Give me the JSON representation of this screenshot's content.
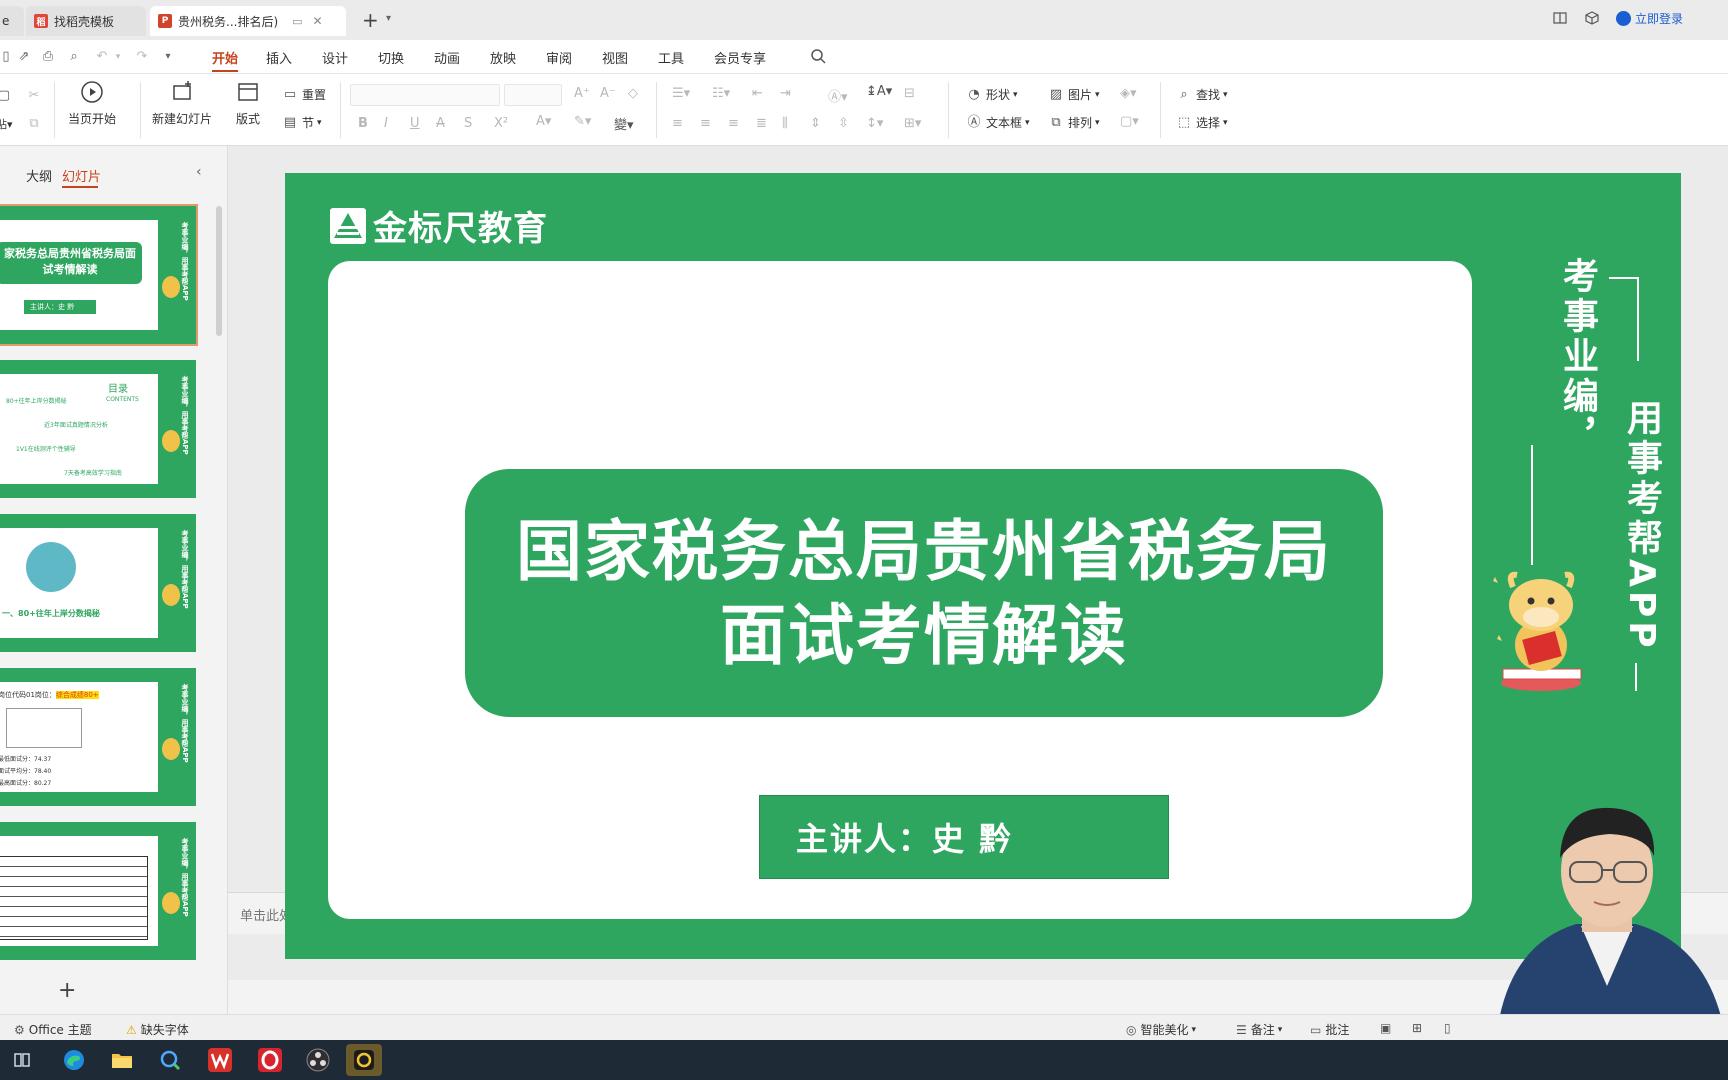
{
  "tabs": [
    {
      "label": "e"
    },
    {
      "label": "找稻壳模板"
    },
    {
      "label": "贵州税务...排名后)"
    }
  ],
  "titlebar": {
    "login_label": "立即登录"
  },
  "menu": {
    "items": [
      "开始",
      "插入",
      "设计",
      "切换",
      "动画",
      "放映",
      "审阅",
      "视图",
      "工具",
      "会员专享"
    ],
    "active": "开始"
  },
  "ribbon": {
    "from_current": "当页开始",
    "new_slide": "新建幻灯片",
    "layout": "版式",
    "reset": "重置",
    "section": "节",
    "shape": "形状",
    "picture": "图片",
    "textbox": "文本框",
    "arrange": "排列",
    "find": "查找",
    "select": "选择"
  },
  "leftpanel": {
    "tab_outline": "大纲",
    "tab_slides": "幻灯片",
    "thumb1_title": "家税务总局贵州省税务局面试考情解读",
    "thumb1_sub": "主讲人：史 黔",
    "thumb2_title": "目录",
    "thumb2_sub": "CONTENTS",
    "thumb2_items": [
      "80+往年上岸分数揭秘",
      "近3年面试真题情况分析",
      "1V1在线测评个性辅导",
      "7天备考高效学习指南"
    ],
    "thumb3_text": "一、80+往年上岸分数揭秘",
    "thumb4_head": "岗位代码01岗位：",
    "thumb4_highlight": "综合成绩80+",
    "thumb4_lines": [
      "最低面试分：74.37",
      "面试平均分：78.40",
      "最高面试分：80.27"
    ],
    "thumb_side": "考事业编，用事考帮APP"
  },
  "slide": {
    "logo_text": "金标尺教育",
    "title_line1": "国家税务总局贵州省税务局",
    "title_line2": "面试考情解读",
    "presenter": "主讲人：史 黔",
    "side_text_1": "考事业编，",
    "side_text_2": "用事考帮APP"
  },
  "notes": {
    "placeholder": "单击此处添加备注"
  },
  "status": {
    "theme": "Office 主题",
    "missing_font": "缺失字体",
    "beautify": "智能美化",
    "notes": "备注",
    "comment": "批注"
  },
  "colors": {
    "slide_green": "#2fa660",
    "accent_orange": "#c7431c",
    "taskbar": "#1f2a37"
  }
}
